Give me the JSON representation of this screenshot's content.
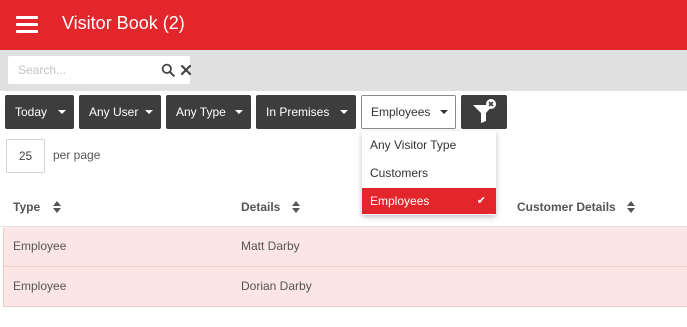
{
  "header": {
    "title": "Visitor Book (2)"
  },
  "search": {
    "placeholder": "Search..."
  },
  "filters": {
    "date": "Today",
    "user": "Any User",
    "type": "Any Type",
    "location": "In Premises",
    "visitor_type_selected": "Employees"
  },
  "visitor_type_menu": {
    "items": [
      "Any Visitor Type",
      "Customers",
      "Employees"
    ],
    "selected_index": 2
  },
  "pagination": {
    "per_page_value": "25",
    "per_page_label": "per page"
  },
  "table": {
    "columns": [
      "Type",
      "Details",
      "Customer Details"
    ],
    "rows": [
      {
        "type": "Employee",
        "details": "Matt Darby"
      },
      {
        "type": "Employee",
        "details": "Dorian Darby"
      }
    ]
  },
  "colors": {
    "brand": "#e3262b",
    "button_dark": "#3d3d3d",
    "row_highlight": "#fbe5e5"
  },
  "icons": [
    "menu-icon",
    "search-icon",
    "close-icon",
    "caret-down-icon",
    "filter-clear-icon",
    "check-icon",
    "sort-icon"
  ]
}
